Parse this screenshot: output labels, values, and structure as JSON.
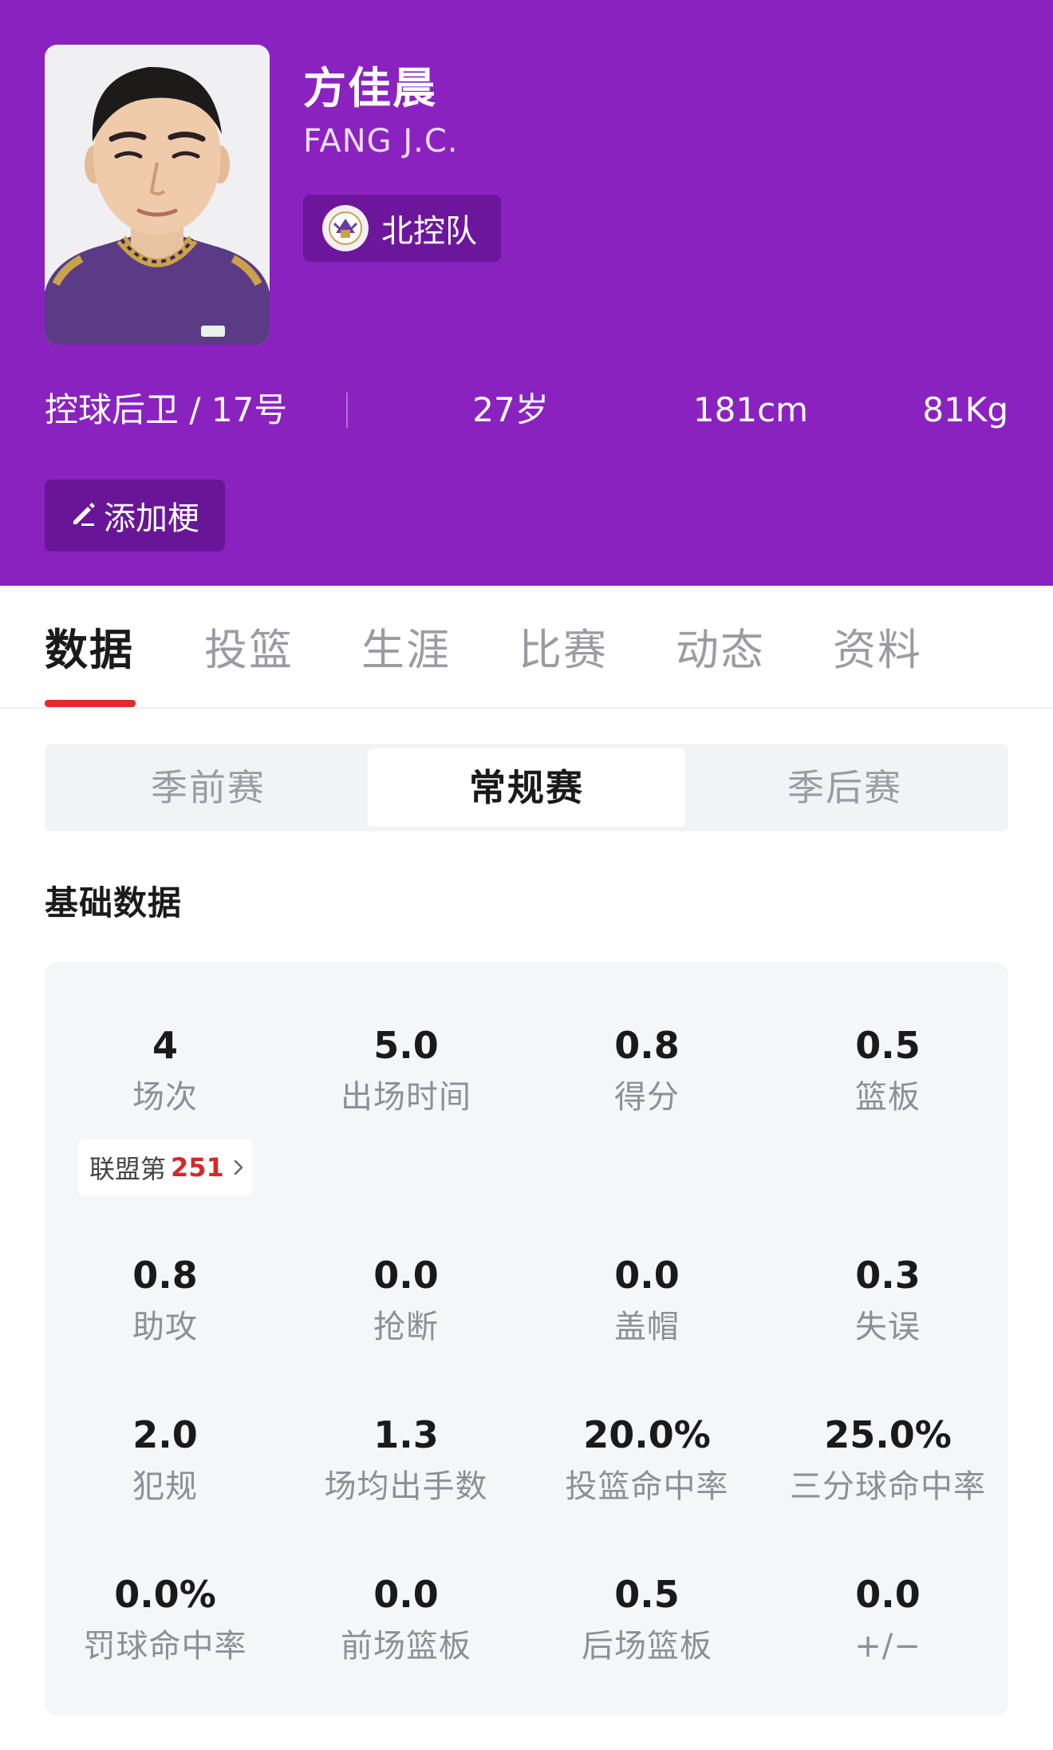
{
  "player": {
    "name_cn": "方佳晨",
    "name_en": "FANG J.C.",
    "team": "北控队",
    "position_number": "控球后卫 / 17号",
    "age": "27岁",
    "height": "181cm",
    "weight": "81Kg"
  },
  "actions": {
    "add_meme": "添加梗"
  },
  "tabs": [
    {
      "label": "数据",
      "active": true
    },
    {
      "label": "投篮",
      "active": false
    },
    {
      "label": "生涯",
      "active": false
    },
    {
      "label": "比赛",
      "active": false
    },
    {
      "label": "动态",
      "active": false
    },
    {
      "label": "资料",
      "active": false
    }
  ],
  "season_segments": [
    {
      "label": "季前赛",
      "active": false
    },
    {
      "label": "常规赛",
      "active": true
    },
    {
      "label": "季后赛",
      "active": false
    }
  ],
  "section_title": "基础数据",
  "rank": {
    "prefix": "联盟第",
    "value": "251"
  },
  "stats": [
    {
      "value": "4",
      "label": "场次"
    },
    {
      "value": "5.0",
      "label": "出场时间"
    },
    {
      "value": "0.8",
      "label": "得分"
    },
    {
      "value": "0.5",
      "label": "篮板"
    },
    {
      "value": "0.8",
      "label": "助攻"
    },
    {
      "value": "0.0",
      "label": "抢断"
    },
    {
      "value": "0.0",
      "label": "盖帽"
    },
    {
      "value": "0.3",
      "label": "失误"
    },
    {
      "value": "2.0",
      "label": "犯规"
    },
    {
      "value": "1.3",
      "label": "场均出手数"
    },
    {
      "value": "20.0%",
      "label": "投篮命中率"
    },
    {
      "value": "25.0%",
      "label": "三分球命中率"
    },
    {
      "value": "0.0%",
      "label": "罚球命中率"
    },
    {
      "value": "0.0",
      "label": "前场篮板"
    },
    {
      "value": "0.5",
      "label": "后场篮板"
    },
    {
      "value": "0.0",
      "label": "+/−"
    }
  ],
  "colors": {
    "header_bg": "#8a22c0",
    "accent_red": "#e52a2a",
    "rank_red": "#d62828",
    "muted_text": "#8e8e96"
  },
  "icons": {
    "team_logo": "team-logo-icon",
    "edit": "pencil-icon",
    "rank_chevron": "chevron-right-icon"
  }
}
